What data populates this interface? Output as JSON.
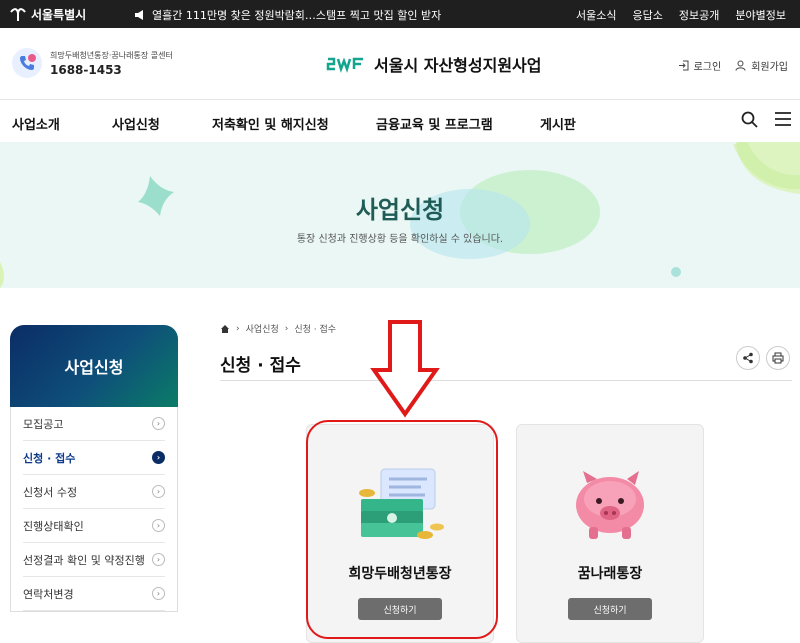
{
  "topbar": {
    "brand": "서울특별시",
    "notice": "열흘간 111만명 찾은 정원박람회…스탬프 찍고 맛집 할인 받자",
    "links": [
      "서울소식",
      "응답소",
      "정보공개",
      "분야별정보"
    ]
  },
  "header": {
    "call_label": "희망두배청년통장·꿈나래통장 콜센터",
    "call_number": "1688-1453",
    "logo_text": "서울시 자산형성지원사업",
    "login": "로그인",
    "signup": "회원가입"
  },
  "gnb": {
    "items": [
      "사업소개",
      "사업신청",
      "저축확인 및 해지신청",
      "금융교육 및 프로그램",
      "게시판"
    ]
  },
  "hero": {
    "title": "사업신청",
    "subtitle": "통장 신청과 진행상황 등을 확인하실 수 있습니다."
  },
  "lnb": {
    "title": "사업신청",
    "items": [
      "모집공고",
      "신청 · 접수",
      "신청서 수정",
      "진행상태확인",
      "선정결과 확인 및 약정진행",
      "연락처변경"
    ],
    "active_index": 1
  },
  "content": {
    "breadcrumb": [
      "사업신청",
      "신청 · 접수"
    ],
    "title": "신청 · 접수"
  },
  "cards": [
    {
      "title": "희망두배청년통장",
      "button": "신청하기"
    },
    {
      "title": "꿈나래통장",
      "button": "신청하기"
    }
  ],
  "colors": {
    "topbar": "#1f1f1f",
    "hero_bg": "#eaf7f4",
    "lnb_head_start": "#0b2d66",
    "lnb_head_end": "#0b7c67",
    "highlight": "#e01919"
  }
}
